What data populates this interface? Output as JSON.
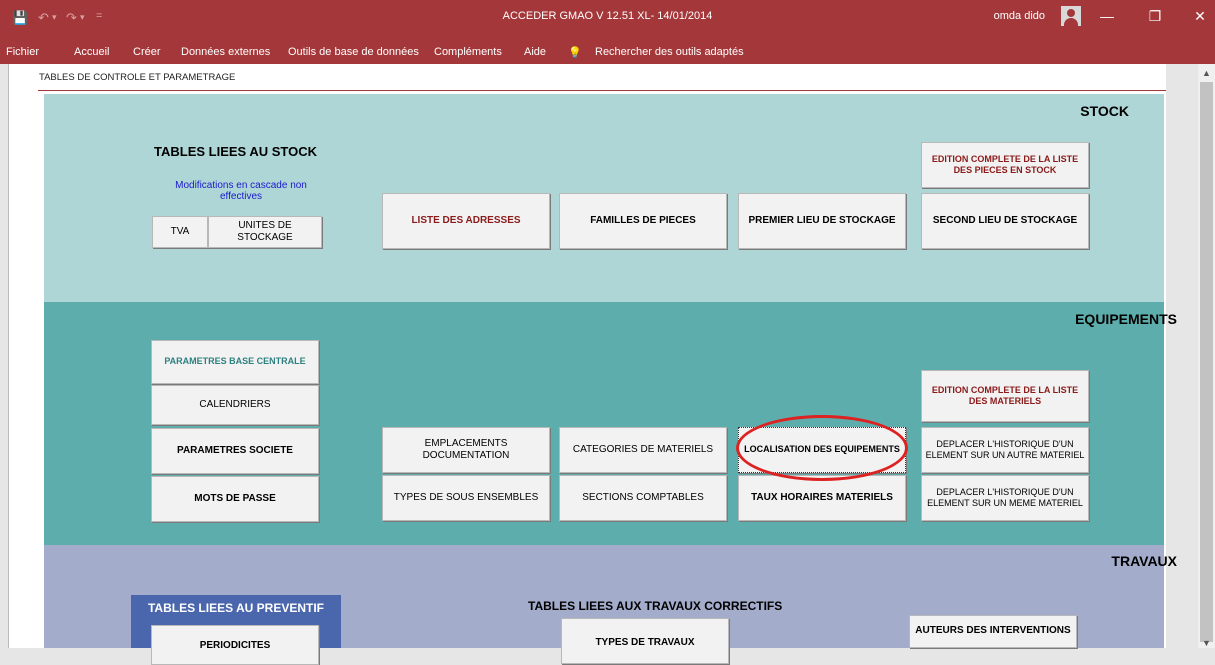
{
  "window": {
    "title": "ACCEDER GMAO V 12.51  XL- 14/01/2014",
    "user": "omda dido",
    "controls": {
      "minimize": "—",
      "restore": "❐",
      "close": "✕"
    }
  },
  "qat": {
    "save": "💾",
    "undo": "↶",
    "undo_arrow": "▾",
    "redo": "↷",
    "redo_arrow": "▾",
    "more": "="
  },
  "menu": {
    "items": [
      "Fichier",
      "Accueil",
      "Créer",
      "Données externes",
      "Outils de base de données",
      "Compléments",
      "Aide"
    ],
    "search_icon": "💡",
    "search_text": "Rechercher des outils adaptés"
  },
  "form": {
    "title": "TABLES DE CONTROLE ET PARAMETRAGE",
    "colors": {
      "accent": "#a4373a",
      "stock": "#aed6d6",
      "equipements": "#5eadad",
      "travaux": "#a3adcb",
      "preventif": "#4a66ad",
      "highlight": "#dd2222"
    },
    "stock": {
      "title": "STOCK",
      "subtitle": "TABLES LIEES AU STOCK",
      "note": "Modifications en cascade non effectives",
      "tva": "TVA",
      "unites": "UNITES DE STOCKAGE",
      "adresses": "LISTE DES ADRESSES",
      "familles": "FAMILLES DE PIECES",
      "premier": "PREMIER LIEU DE STOCKAGE",
      "edition": "EDITION COMPLETE DE LA LISTE DES PIECES EN STOCK",
      "second": "SECOND LIEU DE STOCKAGE"
    },
    "equipements": {
      "title": "EQUIPEMENTS",
      "base_centrale": "PARAMETRES BASE CENTRALE",
      "calendriers": "CALENDRIERS",
      "societe": "PARAMETRES SOCIETE",
      "mots_de_passe": "MOTS DE PASSE",
      "emplacements": "EMPLACEMENTS DOCUMENTATION",
      "sous_ensembles": "TYPES DE SOUS ENSEMBLES",
      "categories": "CATEGORIES DE MATERIELS",
      "sections": "SECTIONS COMPTABLES",
      "localisation": "LOCALISATION DES EQUIPEMENTS",
      "taux": "TAUX HORAIRES MATERIELS",
      "edition": "EDITION  COMPLETE DE LA LISTE DES MATERIELS",
      "deplacer_autre": "DEPLACER L'HISTORIQUE D'UN ELEMENT SUR UN AUTRE MATERIEL",
      "deplacer_meme": "DEPLACER L'HISTORIQUE D'UN ELEMENT SUR UN MEME MATERIEL"
    },
    "travaux": {
      "title": "TRAVAUX",
      "preventif": "TABLES LIEES AU PREVENTIF",
      "periodicites": "PERIODICITES",
      "correctifs": "TABLES LIEES AUX TRAVAUX CORRECTIFS",
      "types_travaux": "TYPES DE TRAVAUX",
      "auteurs": "AUTEURS DES INTERVENTIONS"
    }
  },
  "scrollbar": {
    "up": "▲",
    "down": "▼"
  }
}
